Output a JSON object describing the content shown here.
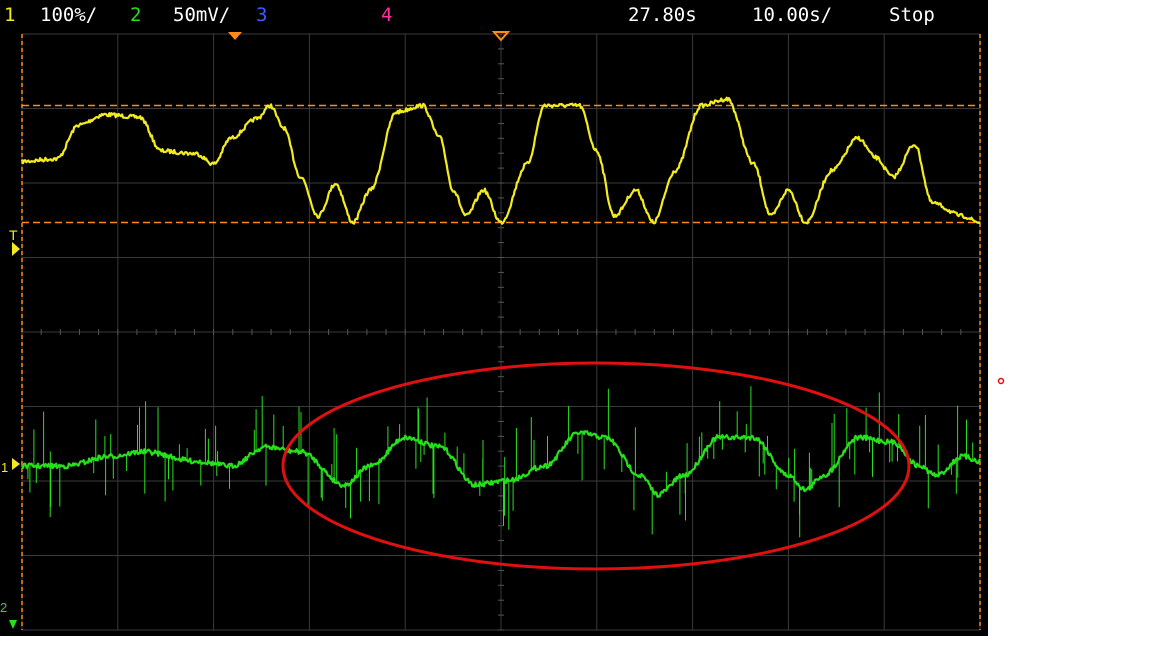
{
  "status_bar": {
    "ch1_number": "1",
    "ch1_scale": "100%/",
    "ch2_number": "2",
    "ch2_scale": "50mV/",
    "ch3_number": "3",
    "ch4_number": "4",
    "time_position": "27.80s",
    "time_scale": "10.00s/",
    "run_state": "Stop"
  },
  "markers": {
    "trigger_label": "T",
    "ch1_ground_label": "1",
    "ch2_ground_label": "2"
  },
  "colors": {
    "ch1": "#f2ec1e",
    "ch2": "#27e01c",
    "ch3": "#3b5cff",
    "ch4": "#ff2ea0",
    "cursor": "#ff8a1a",
    "annotation": "#e01010",
    "grid": "#3a3a3a"
  },
  "grid": {
    "divisions_x": 10,
    "divisions_y": 8
  },
  "ch1_trace": {
    "y_range": [
      0,
      1
    ],
    "points": [
      [
        0.0,
        0.02
      ],
      [
        0.4,
        0.04
      ],
      [
        0.65,
        0.3
      ],
      [
        0.95,
        0.38
      ],
      [
        1.35,
        0.36
      ],
      [
        1.6,
        0.1
      ],
      [
        2.0,
        0.08
      ],
      [
        2.2,
        0.0
      ],
      [
        2.4,
        0.2
      ],
      [
        2.7,
        0.35
      ],
      [
        2.85,
        0.45
      ],
      [
        3.0,
        0.28
      ],
      [
        3.2,
        -0.1
      ],
      [
        3.4,
        -0.4
      ],
      [
        3.6,
        -0.15
      ],
      [
        3.8,
        -0.45
      ],
      [
        4.0,
        -0.2
      ],
      [
        4.3,
        0.4
      ],
      [
        4.6,
        0.45
      ],
      [
        4.8,
        0.2
      ],
      [
        4.95,
        -0.2
      ],
      [
        5.1,
        -0.4
      ],
      [
        5.3,
        -0.2
      ],
      [
        5.5,
        -0.45
      ],
      [
        5.8,
        0.0
      ],
      [
        6.0,
        0.45
      ],
      [
        6.4,
        0.45
      ],
      [
        6.6,
        0.1
      ],
      [
        6.8,
        -0.4
      ],
      [
        7.05,
        -0.2
      ],
      [
        7.25,
        -0.45
      ],
      [
        7.5,
        -0.05
      ],
      [
        7.8,
        0.45
      ],
      [
        8.1,
        0.5
      ],
      [
        8.4,
        0.0
      ],
      [
        8.6,
        -0.4
      ],
      [
        8.8,
        -0.2
      ],
      [
        9.0,
        -0.45
      ],
      [
        9.3,
        -0.05
      ],
      [
        9.6,
        0.2
      ],
      [
        9.8,
        0.05
      ],
      [
        10.0,
        -0.1
      ],
      [
        10.25,
        0.15
      ],
      [
        10.45,
        -0.3
      ],
      [
        10.8,
        -0.4
      ],
      [
        11.0,
        -0.45
      ]
    ]
  },
  "ch2_trace": {
    "y_range": [
      -1,
      1
    ],
    "points": [
      [
        0.0,
        0.0
      ],
      [
        0.5,
        0.0
      ],
      [
        1.0,
        0.1
      ],
      [
        1.4,
        0.15
      ],
      [
        2.0,
        0.05
      ],
      [
        2.4,
        0.0
      ],
      [
        2.8,
        0.2
      ],
      [
        3.2,
        0.15
      ],
      [
        3.7,
        -0.2
      ],
      [
        4.0,
        0.0
      ],
      [
        4.4,
        0.3
      ],
      [
        4.8,
        0.2
      ],
      [
        5.2,
        -0.2
      ],
      [
        5.6,
        -0.15
      ],
      [
        6.0,
        0.0
      ],
      [
        6.4,
        0.35
      ],
      [
        6.7,
        0.3
      ],
      [
        7.1,
        -0.1
      ],
      [
        7.3,
        -0.3
      ],
      [
        7.6,
        -0.1
      ],
      [
        8.0,
        0.3
      ],
      [
        8.4,
        0.3
      ],
      [
        8.8,
        -0.1
      ],
      [
        9.0,
        -0.25
      ],
      [
        9.2,
        -0.1
      ],
      [
        9.6,
        0.3
      ],
      [
        10.0,
        0.25
      ],
      [
        10.3,
        0.0
      ],
      [
        10.5,
        -0.1
      ],
      [
        10.8,
        0.1
      ],
      [
        11.0,
        0.05
      ]
    ]
  },
  "cursors": {
    "upper": 0.45,
    "lower": -0.45
  },
  "annotation": {
    "shape": "ellipse"
  }
}
